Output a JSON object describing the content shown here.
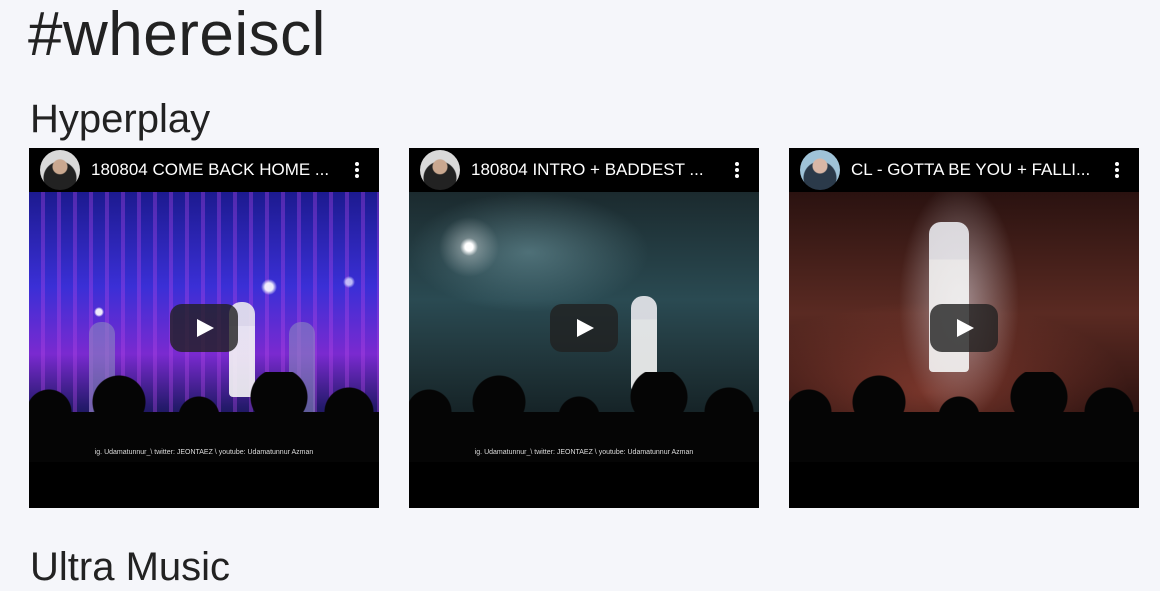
{
  "page": {
    "title": "#whereiscl"
  },
  "sections": [
    {
      "title": "Hyperplay"
    },
    {
      "title": "Ultra Music"
    }
  ],
  "videos": [
    {
      "title": "180804 COME BACK HOME ...",
      "caption": "ig. Udamatunnur_\\ twitter: JEONTAEZ \\ youtube: Udamatunnur Azman",
      "icon": "youtube-embed"
    },
    {
      "title": "180804 INTRO + BADDEST ...",
      "caption": "ig. Udamatunnur_\\ twitter: JEONTAEZ \\ youtube: Udamatunnur Azman",
      "icon": "youtube-embed"
    },
    {
      "title": "CL - GOTTA BE YOU + FALLI...",
      "caption": "",
      "icon": "youtube-embed"
    }
  ],
  "colors": {
    "background": "#f5f6fa",
    "text": "#222222",
    "video_bar": "#000000"
  }
}
